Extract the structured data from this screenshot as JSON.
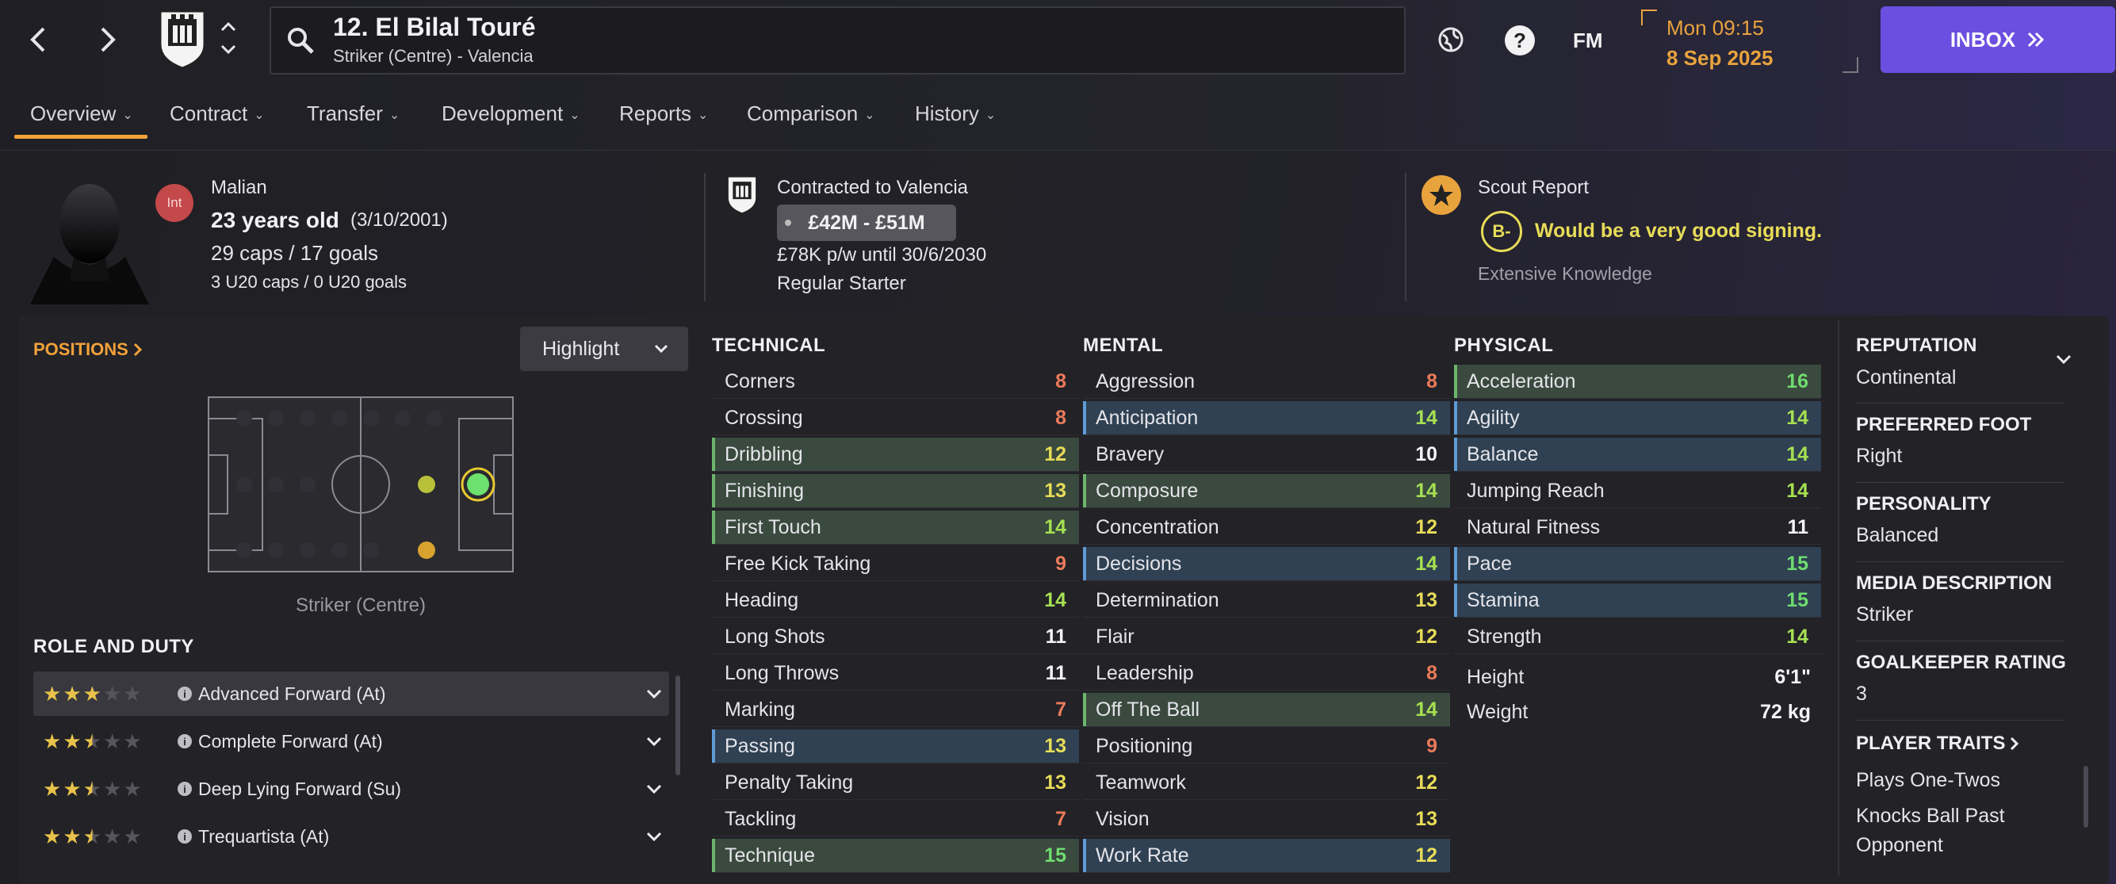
{
  "header": {
    "player_title": "12. El Bilal Touré",
    "player_subtitle": "Striker (Centre) - Valencia",
    "fm_label": "FM",
    "day_time": "Mon 09:15",
    "date": "8 Sep 2025",
    "inbox_label": "INBOX"
  },
  "tabs": [
    {
      "label": "Overview"
    },
    {
      "label": "Contract"
    },
    {
      "label": "Transfer"
    },
    {
      "label": "Development"
    },
    {
      "label": "Reports"
    },
    {
      "label": "Comparison"
    },
    {
      "label": "History"
    }
  ],
  "profile": {
    "int_badge": "Int",
    "nationality": "Malian",
    "age": "23 years old",
    "dob": "(3/10/2001)",
    "caps": "29 caps / 17 goals",
    "u20": "3 U20 caps / 0 U20 goals"
  },
  "contract": {
    "contracted_to": "Contracted to Valencia",
    "value": "£42M - £51M",
    "wage": "£78K p/w until 30/6/2030",
    "status": "Regular Starter"
  },
  "scout": {
    "title": "Scout Report",
    "grade": "B-",
    "verdict": "Would be a very good signing.",
    "knowledge": "Extensive Knowledge"
  },
  "positions": {
    "title": "POSITIONS",
    "highlight_label": "Highlight",
    "position_name": "Striker (Centre)"
  },
  "roles": {
    "title": "ROLE AND DUTY",
    "items": [
      {
        "label": "Advanced Forward (At)",
        "stars": 3
      },
      {
        "label": "Complete Forward (At)",
        "stars": 2.5
      },
      {
        "label": "Deep Lying Forward (Su)",
        "stars": 2.5
      },
      {
        "label": "Trequartista (At)",
        "stars": 2.5
      }
    ]
  },
  "technical": {
    "title": "TECHNICAL",
    "attrs": [
      {
        "name": "Corners",
        "value": "8",
        "tone": "red",
        "hl": ""
      },
      {
        "name": "Crossing",
        "value": "8",
        "tone": "red",
        "hl": ""
      },
      {
        "name": "Dribbling",
        "value": "12",
        "tone": "yellow",
        "hl": "g"
      },
      {
        "name": "Finishing",
        "value": "13",
        "tone": "yellow",
        "hl": "g"
      },
      {
        "name": "First Touch",
        "value": "14",
        "tone": "lgreen",
        "hl": "g"
      },
      {
        "name": "Free Kick Taking",
        "value": "9",
        "tone": "red",
        "hl": ""
      },
      {
        "name": "Heading",
        "value": "14",
        "tone": "lgreen",
        "hl": ""
      },
      {
        "name": "Long Shots",
        "value": "11",
        "tone": "white",
        "hl": ""
      },
      {
        "name": "Long Throws",
        "value": "11",
        "tone": "white",
        "hl": ""
      },
      {
        "name": "Marking",
        "value": "7",
        "tone": "red",
        "hl": ""
      },
      {
        "name": "Passing",
        "value": "13",
        "tone": "yellow",
        "hl": "b"
      },
      {
        "name": "Penalty Taking",
        "value": "13",
        "tone": "yellow",
        "hl": ""
      },
      {
        "name": "Tackling",
        "value": "7",
        "tone": "red",
        "hl": ""
      },
      {
        "name": "Technique",
        "value": "15",
        "tone": "green",
        "hl": "g"
      }
    ]
  },
  "mental": {
    "title": "MENTAL",
    "attrs": [
      {
        "name": "Aggression",
        "value": "8",
        "tone": "red",
        "hl": ""
      },
      {
        "name": "Anticipation",
        "value": "14",
        "tone": "lgreen",
        "hl": "b"
      },
      {
        "name": "Bravery",
        "value": "10",
        "tone": "white",
        "hl": ""
      },
      {
        "name": "Composure",
        "value": "14",
        "tone": "lgreen",
        "hl": "g"
      },
      {
        "name": "Concentration",
        "value": "12",
        "tone": "yellow",
        "hl": ""
      },
      {
        "name": "Decisions",
        "value": "14",
        "tone": "lgreen",
        "hl": "b"
      },
      {
        "name": "Determination",
        "value": "13",
        "tone": "yellow",
        "hl": ""
      },
      {
        "name": "Flair",
        "value": "12",
        "tone": "yellow",
        "hl": ""
      },
      {
        "name": "Leadership",
        "value": "8",
        "tone": "red",
        "hl": ""
      },
      {
        "name": "Off The Ball",
        "value": "14",
        "tone": "lgreen",
        "hl": "g"
      },
      {
        "name": "Positioning",
        "value": "9",
        "tone": "red",
        "hl": ""
      },
      {
        "name": "Teamwork",
        "value": "12",
        "tone": "yellow",
        "hl": ""
      },
      {
        "name": "Vision",
        "value": "13",
        "tone": "yellow",
        "hl": ""
      },
      {
        "name": "Work Rate",
        "value": "12",
        "tone": "yellow",
        "hl": "b"
      }
    ]
  },
  "physical": {
    "title": "PHYSICAL",
    "attrs": [
      {
        "name": "Acceleration",
        "value": "16",
        "tone": "green",
        "hl": "g"
      },
      {
        "name": "Agility",
        "value": "14",
        "tone": "lgreen",
        "hl": "b"
      },
      {
        "name": "Balance",
        "value": "14",
        "tone": "lgreen",
        "hl": "b"
      },
      {
        "name": "Jumping Reach",
        "value": "14",
        "tone": "lgreen",
        "hl": ""
      },
      {
        "name": "Natural Fitness",
        "value": "11",
        "tone": "white",
        "hl": ""
      },
      {
        "name": "Pace",
        "value": "15",
        "tone": "green",
        "hl": "b"
      },
      {
        "name": "Stamina",
        "value": "15",
        "tone": "green",
        "hl": "b"
      },
      {
        "name": "Strength",
        "value": "14",
        "tone": "lgreen",
        "hl": ""
      }
    ],
    "height_label": "Height",
    "height": "6'1\"",
    "weight_label": "Weight",
    "weight": "72 kg"
  },
  "info": {
    "reputation_label": "REPUTATION",
    "reputation": "Continental",
    "foot_label": "PREFERRED FOOT",
    "foot": "Right",
    "personality_label": "PERSONALITY",
    "personality": "Balanced",
    "media_label": "MEDIA DESCRIPTION",
    "media": "Striker",
    "gk_label": "GOALKEEPER RATING",
    "gk": "3",
    "traits_label": "PLAYER TRAITS",
    "traits": [
      "Plays One-Twos",
      "Knocks Ball Past Opponent"
    ]
  },
  "colors": {
    "accent": "#f2a23a",
    "inbox": "#6a4fe0",
    "highlight_green": "#6db56d",
    "highlight_blue": "#5f9bd6"
  }
}
